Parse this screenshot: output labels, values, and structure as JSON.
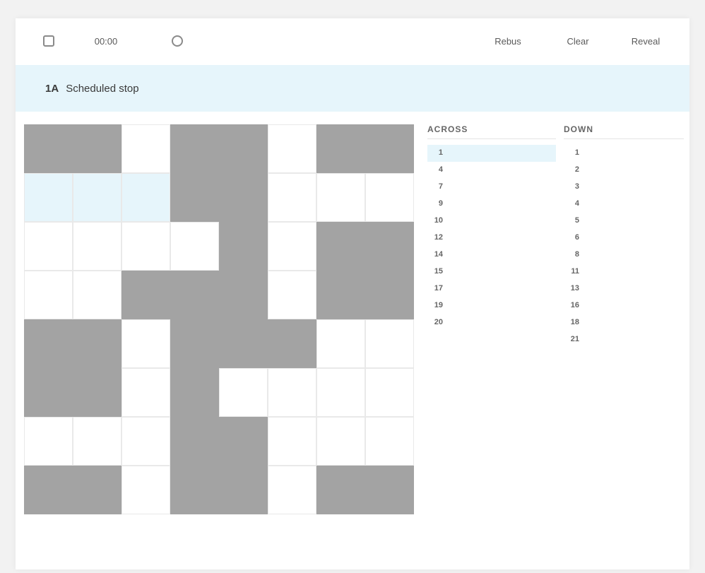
{
  "toolbar": {
    "left_buttons": [
      {
        "name": "menu",
        "icon": "menu-icon",
        "label": ""
      },
      {
        "name": "timer",
        "icon": "",
        "label": "00:00"
      },
      {
        "name": "pause",
        "icon": "pause-icon",
        "label": ""
      }
    ],
    "right_buttons": [
      {
        "name": "rebus",
        "label": "Rebus"
      },
      {
        "name": "clear",
        "label": "Clear"
      },
      {
        "name": "reveal",
        "label": "Reveal"
      }
    ]
  },
  "current_clue": {
    "number": "1A",
    "text": "Scheduled stop"
  },
  "grid": {
    "size": 8,
    "selected_cell": [
      1,
      0
    ],
    "active_word": [
      [
        1,
        0
      ],
      [
        1,
        1
      ],
      [
        1,
        2
      ]
    ],
    "blocks": [
      [
        0,
        0
      ],
      [
        0,
        1
      ],
      [
        0,
        3
      ],
      [
        0,
        4
      ],
      [
        0,
        6
      ],
      [
        0,
        7
      ],
      [
        1,
        3
      ],
      [
        1,
        4
      ],
      [
        2,
        4
      ],
      [
        2,
        6
      ],
      [
        2,
        7
      ],
      [
        3,
        2
      ],
      [
        3,
        3
      ],
      [
        3,
        4
      ],
      [
        3,
        6
      ],
      [
        3,
        7
      ],
      [
        4,
        0
      ],
      [
        4,
        1
      ],
      [
        4,
        3
      ],
      [
        4,
        4
      ],
      [
        4,
        5
      ],
      [
        5,
        0
      ],
      [
        5,
        1
      ],
      [
        5,
        3
      ],
      [
        6,
        3
      ],
      [
        6,
        4
      ],
      [
        7,
        0
      ],
      [
        7,
        1
      ],
      [
        7,
        3
      ],
      [
        7,
        4
      ],
      [
        7,
        6
      ],
      [
        7,
        7
      ]
    ],
    "numbers": []
  },
  "grid_caption": "",
  "across": {
    "heading": "Across",
    "active_index": 0,
    "clues": [
      {
        "num": "1",
        "text": ""
      },
      {
        "num": "4",
        "text": ""
      },
      {
        "num": "7",
        "text": ""
      },
      {
        "num": "9",
        "text": ""
      },
      {
        "num": "10",
        "text": ""
      },
      {
        "num": "12",
        "text": ""
      },
      {
        "num": "14",
        "text": ""
      },
      {
        "num": "15",
        "text": ""
      },
      {
        "num": "17",
        "text": ""
      },
      {
        "num": "19",
        "text": ""
      },
      {
        "num": "20",
        "text": ""
      }
    ]
  },
  "down": {
    "heading": "Down",
    "clues": [
      {
        "num": "1",
        "text": ""
      },
      {
        "num": "2",
        "text": ""
      },
      {
        "num": "3",
        "text": ""
      },
      {
        "num": "4",
        "text": ""
      },
      {
        "num": "5",
        "text": ""
      },
      {
        "num": "6",
        "text": ""
      },
      {
        "num": "8",
        "text": ""
      },
      {
        "num": "11",
        "text": ""
      },
      {
        "num": "13",
        "text": ""
      },
      {
        "num": "16",
        "text": ""
      },
      {
        "num": "18",
        "text": ""
      },
      {
        "num": "21",
        "text": ""
      }
    ]
  },
  "colors": {
    "block": "#a3a3a3",
    "highlight": "#e6f5fb",
    "selected": "#cfeaf8"
  }
}
